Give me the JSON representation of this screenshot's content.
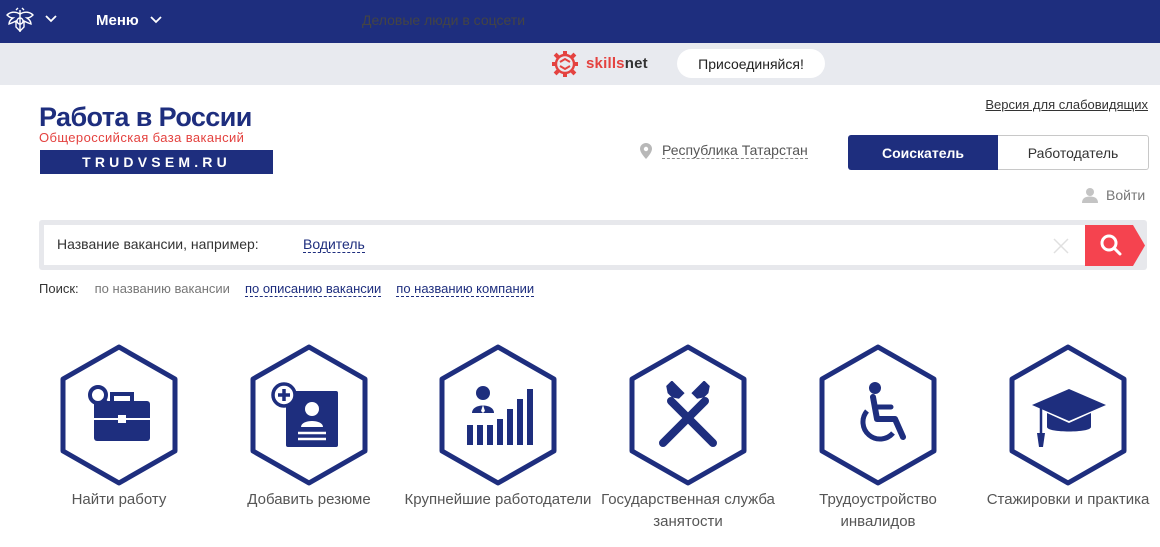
{
  "topbar": {
    "emblem_icon": "russian-emblem-icon",
    "menu_label": "Меню"
  },
  "promo": {
    "text": "Деловые люди в соцсети",
    "brand_red": "skills",
    "brand_dark": "net",
    "join_label": "Присоединяйся!"
  },
  "logo": {
    "title": "Работа в России",
    "subtitle": "Общероссийская база вакансий",
    "domain": "TRUDVSEM.RU"
  },
  "header": {
    "accessibility_link": "Версия для слабовидящих",
    "region": "Республика Татарстан",
    "role_seeker": "Соискатель",
    "role_employer": "Работодатель",
    "login": "Войти"
  },
  "search": {
    "hint": "Название вакансии, например:",
    "example": "Водитель",
    "value": "",
    "placeholder": ""
  },
  "search_modes": {
    "label": "Поиск:",
    "options": [
      "по названию вакансии",
      "по описанию вакансии",
      "по названию компании"
    ]
  },
  "categories": [
    {
      "label": "Найти работу",
      "icon": "briefcase-search-icon"
    },
    {
      "label": "Добавить резюме",
      "icon": "add-resume-icon"
    },
    {
      "label": "Крупнейшие работодатели",
      "icon": "top-employers-icon"
    },
    {
      "label": "Государственная служба занятости",
      "icon": "crossed-hammers-icon"
    },
    {
      "label": "Трудоустройство инвалидов",
      "icon": "wheelchair-icon"
    },
    {
      "label": "Стажировки и практика",
      "icon": "graduation-cap-icon"
    }
  ],
  "colors": {
    "brand_blue": "#1e2e7e",
    "accent_red": "#f5434f",
    "promo_bg": "#e8eaef"
  }
}
